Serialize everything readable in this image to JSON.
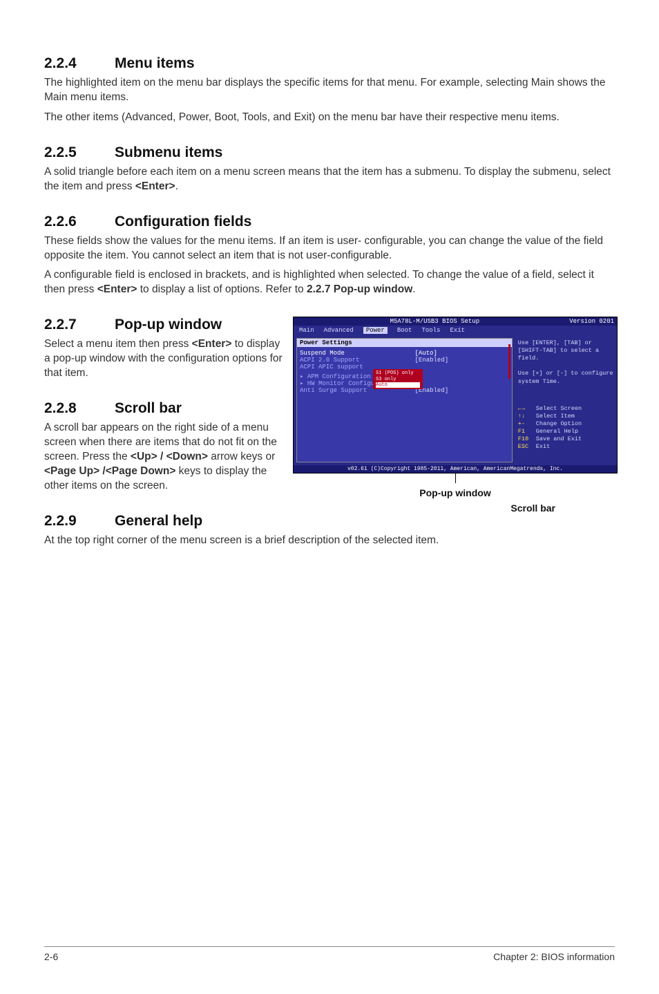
{
  "sections": {
    "s224": {
      "num": "2.2.4",
      "title": "Menu items",
      "p1": "The highlighted item on the menu bar displays the specific items for that menu. For example, selecting Main shows the Main menu items.",
      "p2": "The other items (Advanced, Power, Boot, Tools, and Exit) on the menu bar have their respective menu items."
    },
    "s225": {
      "num": "2.2.5",
      "title": "Submenu items",
      "p1_a": "A solid triangle before each item on a menu screen means that the item has a submenu. To display the submenu, select the item and press ",
      "p1_key": "<Enter>",
      "p1_b": "."
    },
    "s226": {
      "num": "2.2.6",
      "title": "Configuration fields",
      "p1": "These fields show the values for the menu items. If an item is user- configurable, you can change the value of the field opposite the item. You cannot select an item that is not user-configurable.",
      "p2_a": "A configurable field is enclosed in brackets, and is highlighted when selected. To change the value of a field, select it then press ",
      "p2_key": "<Enter>",
      "p2_b": " to display a list of options. Refer to ",
      "p2_ref": "2.2.7 Pop-up window",
      "p2_c": "."
    },
    "s227": {
      "num": "2.2.7",
      "title": "Pop-up window",
      "p1_a": "Select a menu item then press ",
      "p1_key": "<Enter>",
      "p1_b": " to display a pop-up window with the configuration options for that item."
    },
    "s228": {
      "num": "2.2.8",
      "title": "Scroll bar",
      "p1_a": "A scroll bar appears on the right side of a menu screen when there are items that do not fit on the screen. Press the ",
      "p1_key1": "<Up> / <Down>",
      "p1_b": " arrow keys or ",
      "p1_key2": "<Page Up> /<Page Down>",
      "p1_c": " keys to display the other items on the screen."
    },
    "s229": {
      "num": "2.2.9",
      "title": "General help",
      "p1": "At the top right corner of the menu screen is a brief description of the selected item."
    }
  },
  "bios": {
    "title_center": "M5A78L-M/USB3 BIOS Setup",
    "title_right": "Version 0201",
    "menu": [
      "Main",
      "Advanced",
      "Power",
      "Boot",
      "Tools",
      "Exit"
    ],
    "menu_active_index": 2,
    "panel_heading": "Power Settings",
    "rows": [
      {
        "l": "Suspend Mode",
        "r": "[Auto]",
        "sel": true
      },
      {
        "l": "ACPI 2.0 Support",
        "r": "[Enabled]"
      },
      {
        "l": "ACPI APIC support",
        "r": ""
      },
      {
        "l": "▸ APM Configuration",
        "r": ""
      },
      {
        "l": "▸ HW Monitor Configuration",
        "r": ""
      },
      {
        "l": "Anti Surge Support",
        "r": "[Enabled]"
      }
    ],
    "popup": [
      "S1 (POS) only",
      "S3 only",
      "Auto"
    ],
    "help_top": "Use [ENTER], [TAB] or [SHIFT-TAB] to select a field.\n\nUse [+] or [-] to configure system Time.",
    "help_keys": [
      {
        "k": "←→",
        "d": "Select Screen"
      },
      {
        "k": "↑↓",
        "d": "Select Item"
      },
      {
        "k": "+-",
        "d": "Change Option"
      },
      {
        "k": "F1",
        "d": "General Help"
      },
      {
        "k": "F10",
        "d": "Save and Exit"
      },
      {
        "k": "ESC",
        "d": "Exit"
      }
    ],
    "footer": "v02.61 (C)Copyright 1985-2011, American, AmericanMegatrends, Inc.",
    "callout_popup": "Pop-up window",
    "callout_scroll": "Scroll bar"
  },
  "footer": {
    "left": "2-6",
    "right": "Chapter 2: BIOS information"
  },
  "chart_data": null
}
